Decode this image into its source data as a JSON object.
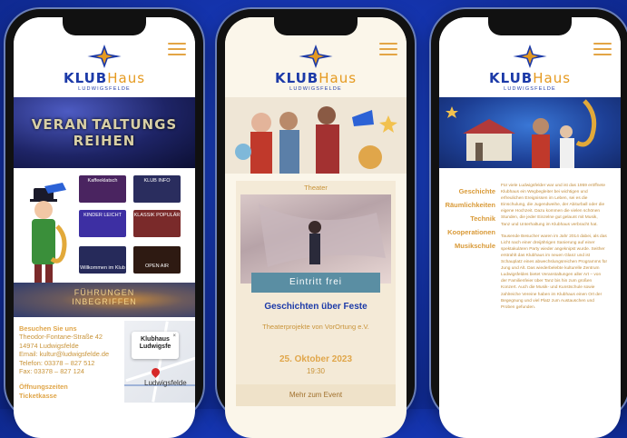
{
  "brand": {
    "name_part1": "KLUB",
    "name_part2": "Haus",
    "subtitle": "LUDWIGSFELDE"
  },
  "phone1": {
    "banner_line1": "VERAN TALTUNGS",
    "banner_line2": "REIHEN",
    "categories": [
      "Kaffeeklatsch",
      "KLUB INFO",
      "KINDER LEICHT",
      "KLASSIK POPULÄR",
      "Willkommen im Klub",
      "OPEN AIR"
    ],
    "tour_line1": "FÜHRUNGEN",
    "tour_line2": "INBEGRIFFEN",
    "contact": {
      "heading": "Besuchen Sie uns",
      "street": "Theodor-Fontane-Straße 42",
      "city": "14974 Ludwigsfelde",
      "email": "Email: kultur@ludwigsfelde.de",
      "phone": "Telefon: 03378 – 827 512",
      "fax": "Fax: 03378 – 827 124",
      "hours_heading": "Öffnungszeiten",
      "hours_sub": "Ticketkasse"
    },
    "map": {
      "popup_line1": "Klubhaus",
      "popup_line2": "Ludwigsfe",
      "close": "×",
      "label": "Ludwigsfelde"
    }
  },
  "phone2": {
    "category": "Theater",
    "badge": "Eintritt frei",
    "title": "Geschichten über Feste",
    "subtitle": "Theaterprojekte von VorOrtung e.V.",
    "date": "25. Oktober 2023",
    "time": "19:30",
    "more": "Mehr zum Event"
  },
  "phone3": {
    "nav": [
      "Geschichte",
      "Räumlichkeiten",
      "Technik",
      "Kooperationen",
      "Musikschule"
    ],
    "para1": "Für viele Ludwigsfelder war und ist das 1959 eröffnete Klubhaus ein Wegbegleiter bei wichtigen und erfreulichen Ereignissen im Leben, sei es die Einschulung, die Jugendweihe, der Abiturball oder die eigene Hochzeit. Dazu kommen die vielen schönen Stunden, die jeder Einzelne gut gelaunt mit Musik, Tanz und Unterhaltung im Klubhaus verbracht hat.",
    "para2": "Tausende Besucher waren im Jahr 2014 dabei, als das Licht nach einer dreijährigen Sanierung auf einer spektakulären Party wieder angeknipst wurde. Seither erstrahlt das Klubhaus im neuen Glanz und ist Schauplatz eines abwechslungsreichen Programms für Jung und Alt. Das wiederbelebte kulturelle Zentrum Ludwigsfeldes bietet Veranstaltungen aller Art – von der Familienfeier über Tanz bis hin zum großen Konzert. Auch die Musik- und Kunstschule sowie zahlreiche Vereine haben im Klubhaus einen Ort der Begegnung und viel Platz zum Austauschen und Proben gefunden."
  },
  "colors": {
    "background": "#1535b0",
    "brand_blue": "#1c3aa8",
    "accent_gold": "#e0a64a",
    "cream": "#fbf6ea"
  }
}
